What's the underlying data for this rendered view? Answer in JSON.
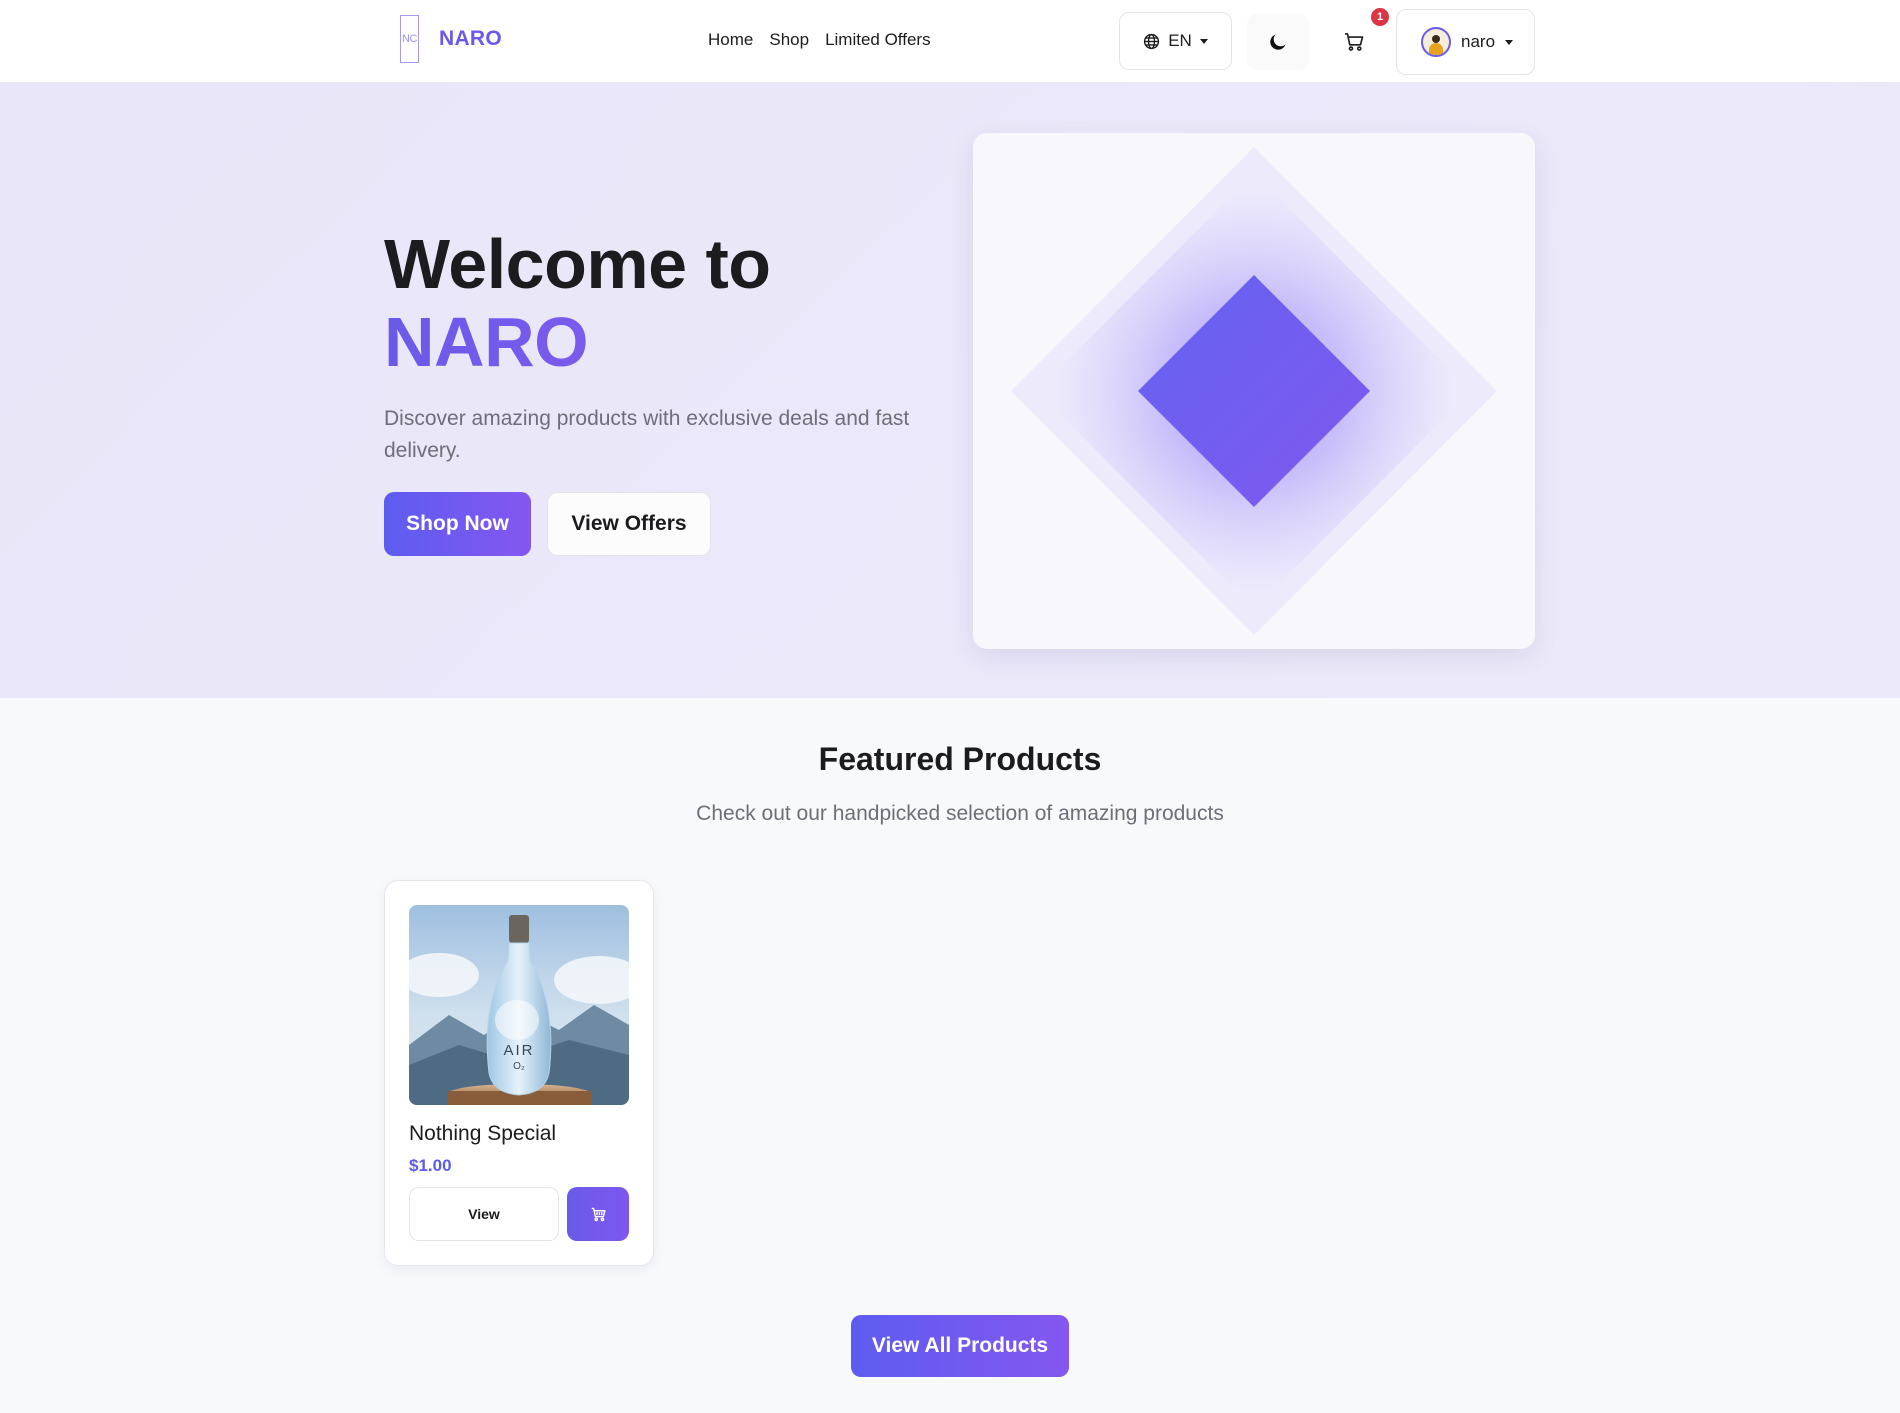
{
  "brand": {
    "logo_text": "NC",
    "name": "NARO",
    "accent_color": "#6a5ae8"
  },
  "nav": {
    "links": [
      {
        "label": "Home"
      },
      {
        "label": "Shop"
      },
      {
        "label": "Limited Offers"
      }
    ]
  },
  "toolbar": {
    "language": "EN",
    "language_icon": "globe-icon",
    "theme_icon": "moon-icon",
    "cart_icon": "cart-icon",
    "cart_count": "1",
    "badge_color": "#dc3545",
    "username": "naro"
  },
  "hero": {
    "title_line1": "Welcome to",
    "title_line2": "NARO",
    "subtitle": "Discover amazing products with exclusive deals and fast delivery.",
    "primary_button": "Shop Now",
    "secondary_button": "View Offers"
  },
  "featured": {
    "title": "Featured Products",
    "subtitle": "Check out our handpicked selection of amazing products",
    "products": [
      {
        "name": "Nothing Special",
        "price": "$1.00",
        "image_label": "AIR",
        "image_label_sub": "O₂",
        "view_button": "View",
        "cart_icon": "cart-icon"
      }
    ],
    "view_all_button": "View All Products"
  }
}
